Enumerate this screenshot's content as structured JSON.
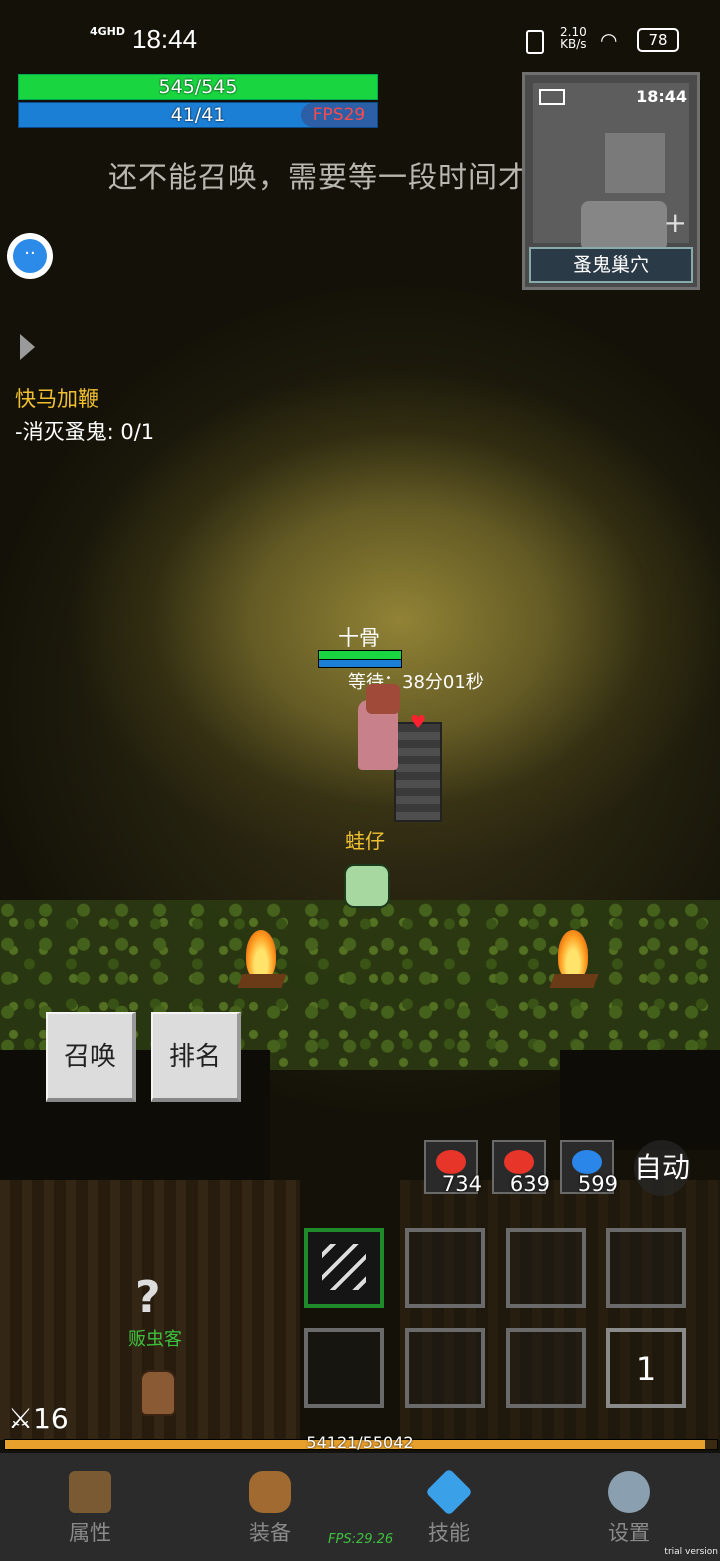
{
  "status_bar": {
    "network": "4GHD",
    "time": "18:44",
    "speed_value": "2.10",
    "speed_unit": "KB/s",
    "battery": "78"
  },
  "player": {
    "hp_text": "545/545",
    "mp_text": "41/41",
    "fps_label": "FPS29"
  },
  "notice": "还不能召唤，需要等一段时间才行!",
  "minimap": {
    "time": "18:44",
    "location": "蚤鬼巢穴"
  },
  "quest": {
    "title": "快马加鞭",
    "objective": "-消灭蚤鬼: 0/1"
  },
  "npc": {
    "name": "十骨",
    "wait_text": "等待：38分01秒"
  },
  "pet": {
    "name": "蛙仔"
  },
  "buttons": {
    "summon": "召唤",
    "ranking": "排名",
    "auto": "自动"
  },
  "potions": [
    {
      "count": "734",
      "color": "#e8352a"
    },
    {
      "count": "639",
      "color": "#e8352a"
    },
    {
      "count": "599",
      "color": "#2a86e8"
    }
  ],
  "skill_page": "1",
  "merchant": {
    "name": "贩虫客"
  },
  "level": "16",
  "xp": {
    "text": "54121/55042",
    "fraction": 0.983
  },
  "bottom_nav": [
    {
      "label": "属性",
      "icon": "helmet-icon"
    },
    {
      "label": "装备",
      "icon": "bag-icon"
    },
    {
      "label": "技能",
      "icon": "crystal-icon"
    },
    {
      "label": "设置",
      "icon": "gear-icon"
    }
  ],
  "fps_bottom": "FPS:29.26",
  "watermark": "trial version"
}
